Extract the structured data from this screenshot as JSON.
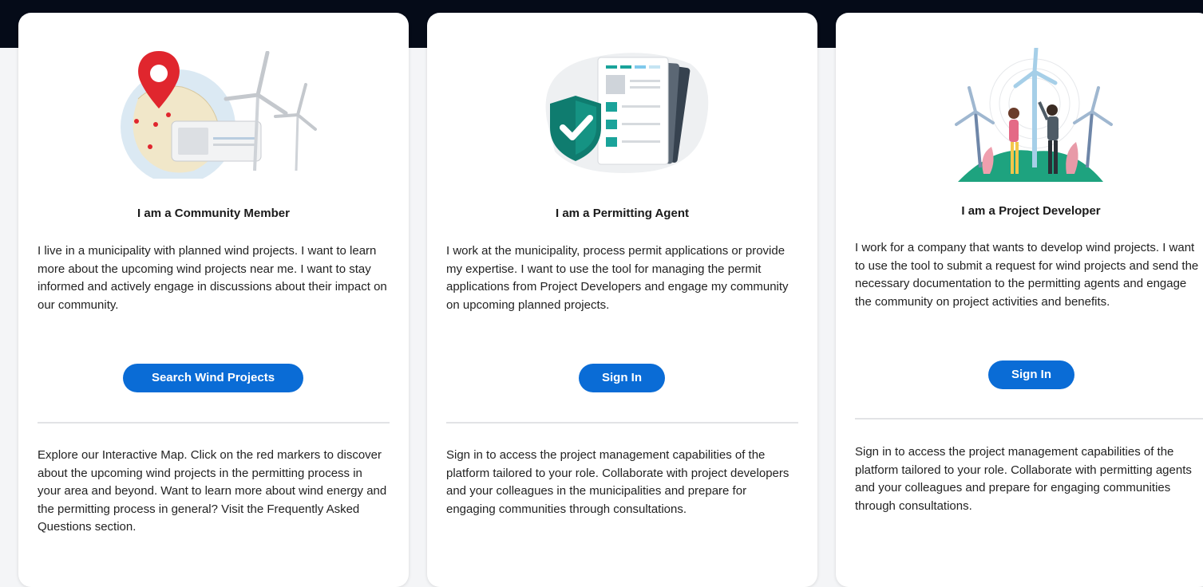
{
  "colors": {
    "top_band": "#050b18",
    "primary_button": "#0a6cd6",
    "card_bg": "#ffffff",
    "page_bg": "#f4f5f7"
  },
  "cards": [
    {
      "illustration": "map-pin-wind-turbines-illustration",
      "title": "I am a Community Member",
      "description": "I live in a municipality with planned wind projects. I want to learn more about the upcoming wind projects near me. I want to stay informed and actively engage in discussions about their impact on our community.",
      "button_label": "Search Wind Projects",
      "footer_text": "Explore our Interactive Map. Click on the red markers to discover about the upcoming wind projects in the permitting process in your area and beyond. Want to learn more about wind energy and the permitting process in general? Visit the Frequently Asked Questions section."
    },
    {
      "illustration": "shield-checklist-documents-illustration",
      "title": "I am a Permitting Agent",
      "description": "I work at the municipality, process permit applications or provide my expertise. I want to use the tool for managing the permit applications from Project Developers and engage my community on upcoming planned projects.",
      "button_label": "Sign In",
      "footer_text": "Sign in to access the project management capabilities of the platform tailored to your role. Collaborate with project developers and your colleagues in the municipalities and prepare for engaging communities through consultations."
    },
    {
      "illustration": "people-wind-turbines-illustration",
      "title": "I am a Project Developer",
      "description": "I work for a company that wants to develop wind projects. I want to use the tool to submit a request for wind projects and send the necessary documentation to the permitting agents and engage the community on project activities and benefits.",
      "button_label": "Sign In",
      "footer_text": "Sign in to access the project management capabilities of the platform tailored to your role. Collaborate with permitting agents and your colleagues and prepare for engaging communities through consultations."
    }
  ]
}
